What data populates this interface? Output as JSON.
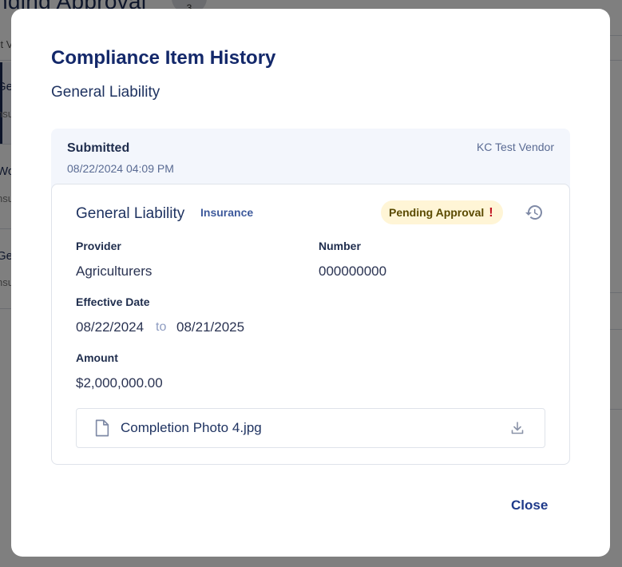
{
  "background": {
    "page_title": "nding Approval",
    "count_badge": "3",
    "tab_text": "st V",
    "rows": [
      {
        "title": "Ger",
        "sub": "nsu"
      },
      {
        "title": "Wo",
        "sub": "nsu"
      },
      {
        "title": "Ger",
        "sub": "nsu"
      }
    ]
  },
  "modal": {
    "title": "Compliance Item History",
    "subtitle": "General Liability",
    "entry": {
      "status_label": "Submitted",
      "date": "08/22/2024 04:09 PM",
      "vendor": "KC Test Vendor"
    },
    "item": {
      "title": "General Liability",
      "type": "Insurance",
      "status_badge": "Pending Approval",
      "status_mark": "!",
      "status_color": "#fff5d6",
      "fields": {
        "provider_label": "Provider",
        "provider_value": "Agriculturers",
        "number_label": "Number",
        "number_value": "000000000",
        "effective_label": "Effective Date",
        "effective_start": "08/22/2024",
        "effective_to": "to",
        "effective_end": "08/21/2025",
        "amount_label": "Amount",
        "amount_value": "$2,000,000.00"
      },
      "attachment": {
        "file_name": "Completion Photo 4.jpg",
        "icon": "file-icon",
        "action_icon": "download-icon"
      }
    },
    "close_label": "Close"
  },
  "colors": {
    "accent": "#13286a",
    "badge_bg": "#fff5d6",
    "alert": "#c0121f"
  }
}
